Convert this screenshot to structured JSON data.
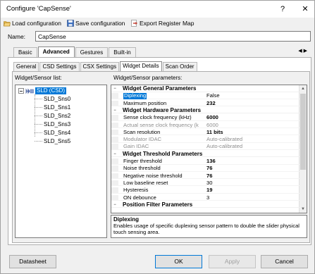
{
  "window": {
    "title": "Configure 'CapSense'",
    "help_glyph": "?",
    "close_glyph": "✕"
  },
  "toolbar": {
    "load_label": "Load configuration",
    "save_label": "Save configuration",
    "export_label": "Export Register Map",
    "load_icon": "folder-open-icon",
    "save_icon": "floppy-disk-icon",
    "export_icon": "export-icon"
  },
  "name_field": {
    "label": "Name:",
    "value": "CapSense"
  },
  "main_tabs": {
    "items": [
      "Basic",
      "Advanced",
      "Gestures",
      "Built-in"
    ],
    "active": "Advanced",
    "scroll_left": "◀",
    "scroll_right": "▶"
  },
  "sub_tabs": {
    "items": [
      "General",
      "CSD Settings",
      "CSX Settings",
      "Widget Details",
      "Scan Order"
    ],
    "active": "Widget Details"
  },
  "left_panel": {
    "label": "Widget/Sensor list:",
    "root": {
      "label": "SLD (CSD)",
      "children": [
        "SLD_Sns0",
        "SLD_Sns1",
        "SLD_Sns2",
        "SLD_Sns3",
        "SLD_Sns4",
        "SLD_Sns5"
      ]
    }
  },
  "right_panel": {
    "label": "Widget/Sensor parameters:",
    "categories": [
      {
        "title": "Widget General Parameters",
        "toggle": "−",
        "params": [
          {
            "name": "Diplexing",
            "value": "False",
            "bold": false,
            "disabled": false,
            "selected": true
          },
          {
            "name": "Maximum position",
            "value": "232",
            "bold": true,
            "disabled": false,
            "selected": false
          }
        ]
      },
      {
        "title": "Widget Hardware Parameters",
        "toggle": "−",
        "params": [
          {
            "name": "Sense clock frequency (kHz)",
            "value": "6000",
            "bold": true,
            "disabled": false,
            "selected": false
          },
          {
            "name": "Actual sense clock frequency (k",
            "value": "6000",
            "bold": false,
            "disabled": true,
            "selected": false
          },
          {
            "name": "Scan resolution",
            "value": "11 bits",
            "bold": true,
            "disabled": false,
            "selected": false
          },
          {
            "name": "Modulator IDAC",
            "value": "Auto-calibrated",
            "bold": false,
            "disabled": true,
            "selected": false
          },
          {
            "name": "Gain IDAC",
            "value": "Auto-calibrated",
            "bold": false,
            "disabled": true,
            "selected": false
          }
        ]
      },
      {
        "title": "Widget Threshold Parameters",
        "toggle": "−",
        "params": [
          {
            "name": "Finger threshold",
            "value": "136",
            "bold": true,
            "disabled": false,
            "selected": false
          },
          {
            "name": "Noise threshold",
            "value": "76",
            "bold": true,
            "disabled": false,
            "selected": false
          },
          {
            "name": "Negative noise threshold",
            "value": "76",
            "bold": true,
            "disabled": false,
            "selected": false
          },
          {
            "name": "Low baseline reset",
            "value": "30",
            "bold": false,
            "disabled": false,
            "selected": false
          },
          {
            "name": "Hysteresis",
            "value": "19",
            "bold": true,
            "disabled": false,
            "selected": false
          },
          {
            "name": "ON debounce",
            "value": "3",
            "bold": false,
            "disabled": false,
            "selected": false
          }
        ]
      },
      {
        "title": "Position Filter Parameters",
        "toggle": "−",
        "params": []
      }
    ],
    "scroll_up": "▲",
    "scroll_down": "▼"
  },
  "description": {
    "title": "Diplexing",
    "text": "Enables usage of specific duplexing sensor pattern to double the slider physical touch sensing area."
  },
  "buttons": {
    "datasheet": "Datasheet",
    "ok": "OK",
    "apply": "Apply",
    "cancel": "Cancel"
  },
  "colors": {
    "selection": "#0078d7",
    "window_bg": "#f0f0f0",
    "disabled_text": "#8d8d8d"
  }
}
